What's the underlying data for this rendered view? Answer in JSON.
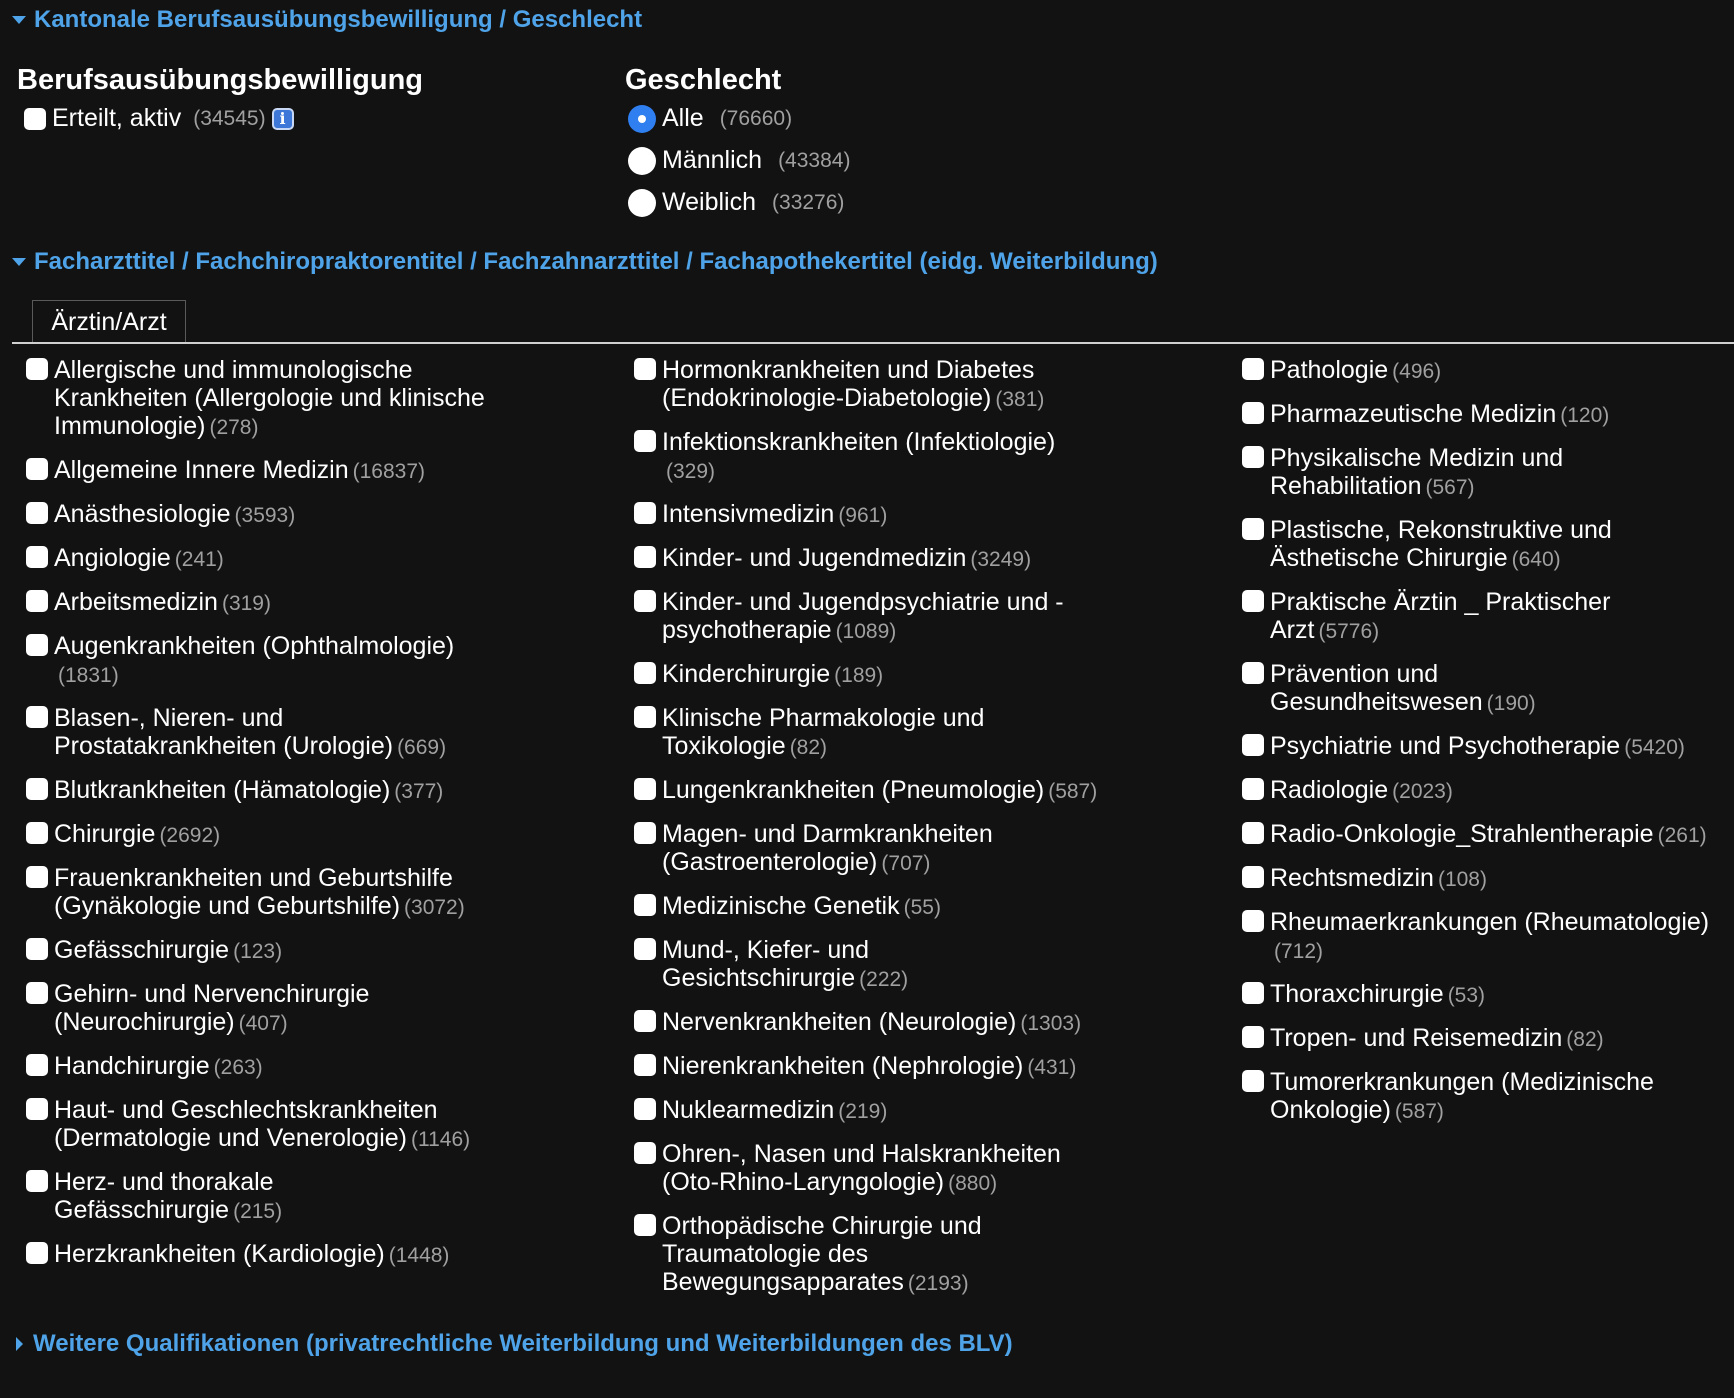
{
  "section1": {
    "title": "Kantonale Berufsausübungsbewilligung / Geschlecht",
    "permit": {
      "heading": "Berufsausübungsbewilligung",
      "option": {
        "label": "Erteilt, aktiv",
        "count": "(34545)",
        "checked": false
      },
      "info_icon": "info-icon"
    },
    "gender": {
      "heading": "Geschlecht",
      "options": [
        {
          "label": "Alle",
          "count": "(76660)",
          "checked": true
        },
        {
          "label": "Männlich",
          "count": "(43384)",
          "checked": false
        },
        {
          "label": "Weiblich",
          "count": "(33276)",
          "checked": false
        }
      ]
    }
  },
  "section2": {
    "title": "Facharzttitel / Fachchiropraktorentitel / Fachzahnarzttitel / Fachapothekertitel (eidg. Weiterbildung)",
    "tab_label": "Ärztin/Arzt",
    "columns": [
      [
        {
          "label": "Allergische und immunologische Krankheiten (Allergologie und klinische Immunologie)",
          "count": "(278)"
        },
        {
          "label": "Allgemeine Innere Medizin",
          "count": "(16837)"
        },
        {
          "label": "Anästhesiologie",
          "count": "(3593)"
        },
        {
          "label": "Angiologie",
          "count": "(241)"
        },
        {
          "label": "Arbeitsmedizin",
          "count": "(319)"
        },
        {
          "label": "Augenkrankheiten (Ophthalmologie)",
          "count": "(1831)"
        },
        {
          "label": "Blasen-, Nieren- und Prostatakrankheiten (Urologie)",
          "count": "(669)"
        },
        {
          "label": "Blutkrankheiten (Hämatologie)",
          "count": "(377)"
        },
        {
          "label": "Chirurgie",
          "count": "(2692)"
        },
        {
          "label": "Frauenkrankheiten und Geburtshilfe (Gynäkologie und Geburtshilfe)",
          "count": "(3072)"
        },
        {
          "label": "Gefässchirurgie",
          "count": "(123)"
        },
        {
          "label": "Gehirn- und Nervenchirurgie (Neurochirurgie)",
          "count": "(407)"
        },
        {
          "label": "Handchirurgie",
          "count": "(263)"
        },
        {
          "label": "Haut- und Geschlechtskrankheiten (Dermatologie und Venerologie)",
          "count": "(1146)"
        },
        {
          "label": "Herz- und thorakale Gefässchirurgie",
          "count": "(215)"
        },
        {
          "label": "Herzkrankheiten (Kardiologie)",
          "count": "(1448)"
        }
      ],
      [
        {
          "label": "Hormonkrankheiten und Diabetes (Endokrinologie-Diabetologie)",
          "count": "(381)"
        },
        {
          "label": "Infektionskrankheiten (Infektiologie)",
          "count": "(329)"
        },
        {
          "label": "Intensivmedizin",
          "count": "(961)"
        },
        {
          "label": "Kinder- und Jugendmedizin",
          "count": "(3249)"
        },
        {
          "label": "Kinder- und Jugendpsychiatrie und -psychotherapie",
          "count": "(1089)"
        },
        {
          "label": "Kinderchirurgie",
          "count": "(189)"
        },
        {
          "label": "Klinische Pharmakologie und Toxikologie",
          "count": "(82)"
        },
        {
          "label": "Lungenkrankheiten (Pneumologie)",
          "count": "(587)"
        },
        {
          "label": "Magen- und Darmkrankheiten (Gastroenterologie)",
          "count": "(707)"
        },
        {
          "label": "Medizinische Genetik",
          "count": "(55)"
        },
        {
          "label": "Mund-, Kiefer- und Gesichtschirurgie",
          "count": "(222)"
        },
        {
          "label": "Nervenkrankheiten (Neurologie)",
          "count": "(1303)"
        },
        {
          "label": "Nierenkrankheiten (Nephrologie)",
          "count": "(431)"
        },
        {
          "label": "Nuklearmedizin",
          "count": "(219)"
        },
        {
          "label": "Ohren-, Nasen und Halskrankheiten (Oto-Rhino-Laryngologie)",
          "count": "(880)"
        },
        {
          "label": "Orthopädische Chirurgie und Traumatologie des Bewegungsapparates",
          "count": "(2193)"
        }
      ],
      [
        {
          "label": "Pathologie",
          "count": "(496)"
        },
        {
          "label": "Pharmazeutische Medizin",
          "count": "(120)"
        },
        {
          "label": "Physikalische Medizin und Rehabilitation",
          "count": "(567)"
        },
        {
          "label": "Plastische, Rekonstruktive und Ästhetische Chirurgie",
          "count": "(640)"
        },
        {
          "label": "Praktische Ärztin _ Praktischer Arzt",
          "count": "(5776)"
        },
        {
          "label": "Prävention und Gesundheitswesen",
          "count": "(190)"
        },
        {
          "label": "Psychiatrie und Psychotherapie",
          "count": "(5420)"
        },
        {
          "label": "Radiologie",
          "count": "(2023)"
        },
        {
          "label": "Radio-Onkologie_Strahlentherapie",
          "count": "(261)"
        },
        {
          "label": "Rechtsmedizin",
          "count": "(108)"
        },
        {
          "label": "Rheumaerkrankungen (Rheumatologie)",
          "count": "(712)"
        },
        {
          "label": "Thoraxchirurgie",
          "count": "(53)"
        },
        {
          "label": "Tropen- und Reisemedizin",
          "count": "(82)"
        },
        {
          "label": "Tumorerkrankungen (Medizinische Onkologie)",
          "count": "(587)"
        }
      ]
    ]
  },
  "section3": {
    "title": "Weitere Qualifikationen (privatrechtliche Weiterbildung und Weiterbildungen des BLV)"
  },
  "colors": {
    "background": "#121212",
    "link": "#4fa3e8",
    "count": "#a0a0a0",
    "radio_selected": "#2f7ff0"
  }
}
